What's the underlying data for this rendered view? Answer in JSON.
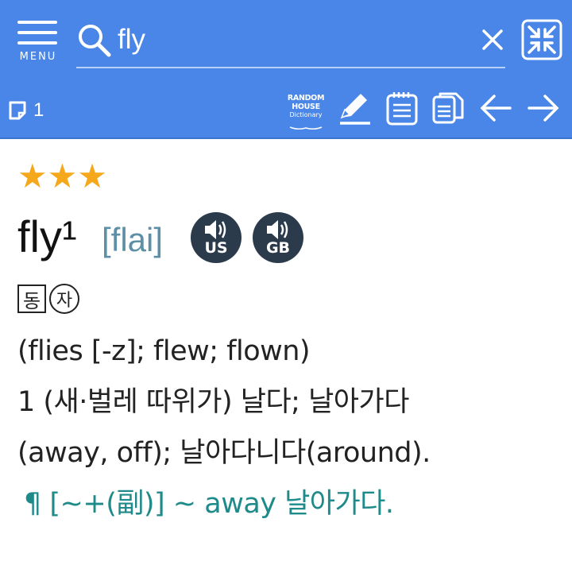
{
  "header": {
    "menu_label": "MENU",
    "search": {
      "value": "fly",
      "placeholder": ""
    },
    "page_count": "1",
    "dictionary_logo": {
      "line1": "RANDOM",
      "line2": "HOUSE",
      "line3": "Dictionary"
    },
    "icons": {
      "menu": "hamburger-icon",
      "search": "search-icon",
      "clear": "close-icon",
      "compress": "compress-icon",
      "page": "page-icon",
      "edit": "pencil-icon",
      "notes": "notepad-icon",
      "copy": "copy-icon",
      "back": "arrow-left-icon",
      "forward": "arrow-right-icon"
    },
    "colors": {
      "bar": "#4a86e8",
      "text": "#ffffff"
    }
  },
  "entry": {
    "stars": "★★★",
    "headword": "fly¹",
    "pronunciation": "[flai]",
    "audio": [
      {
        "label": "US"
      },
      {
        "label": "GB"
      }
    ],
    "pos_box": "동",
    "pos_circle": "자",
    "forms": "(flies [-z]; flew; flown)",
    "def_line1": "1 (새·벌레 따위가) 날다; 날아가다",
    "def_line2": "(away, off); 날아다니다(around).",
    "example": "¶ [~+(副)] ~ away 날아가다.",
    "colors": {
      "star": "#f5a81c",
      "pronunciation": "#5d8fa6",
      "example": "#1f8a8a",
      "audio_bg": "#2b3b4c"
    }
  }
}
